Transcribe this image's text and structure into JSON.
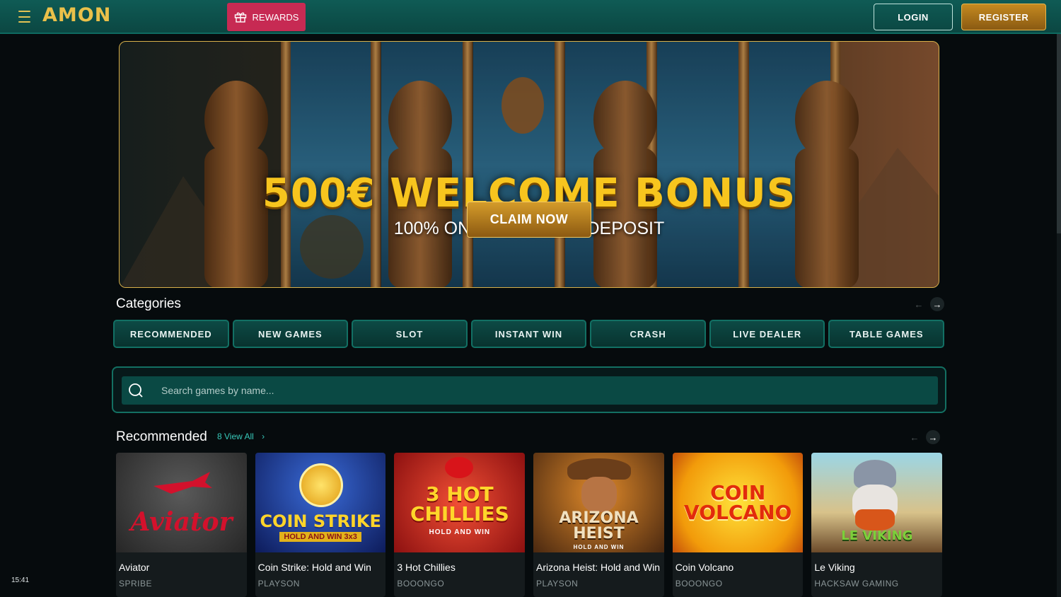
{
  "header": {
    "logo": "AMON",
    "rewards_label": "REWARDS",
    "login_label": "LOGIN",
    "register_label": "REGISTER"
  },
  "banner": {
    "title": "500€ WELCOME BONUS",
    "subtitle": "100% ON YOUR FIRST DEPOSIT",
    "cta_label": "CLAIM NOW"
  },
  "categories": {
    "title": "Categories",
    "items": [
      "RECOMMENDED",
      "NEW GAMES",
      "SLOT",
      "INSTANT WIN",
      "CRASH",
      "LIVE DEALER",
      "TABLE GAMES"
    ]
  },
  "search": {
    "placeholder": "Search games by name..."
  },
  "recommended": {
    "title": "Recommended",
    "view_all": "8 View All",
    "games": [
      {
        "name": "Aviator",
        "provider": "SPRIBE",
        "art_text": "Aviator"
      },
      {
        "name": "Coin Strike: Hold and Win",
        "provider": "PLAYSON",
        "art_text": "COIN STRIKE",
        "art_sub": "HOLD AND WIN 3x3"
      },
      {
        "name": "3 Hot Chillies",
        "provider": "BOOONGO",
        "art_text": "3 HOT CHILLIES",
        "art_sub": "HOLD AND WIN"
      },
      {
        "name": "Arizona Heist: Hold and Win",
        "provider": "PLAYSON",
        "art_text": "ARIZONA HEIST",
        "art_sub": "HOLD AND WIN"
      },
      {
        "name": "Coin Volcano",
        "provider": "BOOONGO",
        "art_text": "COIN VOLCANO"
      },
      {
        "name": "Le Viking",
        "provider": "HACKSAW GAMING",
        "art_text": "LE VIKING"
      }
    ]
  },
  "status": {
    "clock": "15:41"
  },
  "colors": {
    "header_bg": "#0f5b55",
    "gold": "#f7c51e",
    "rewards": "#c72a53",
    "teal_accent": "#38c9ba"
  }
}
